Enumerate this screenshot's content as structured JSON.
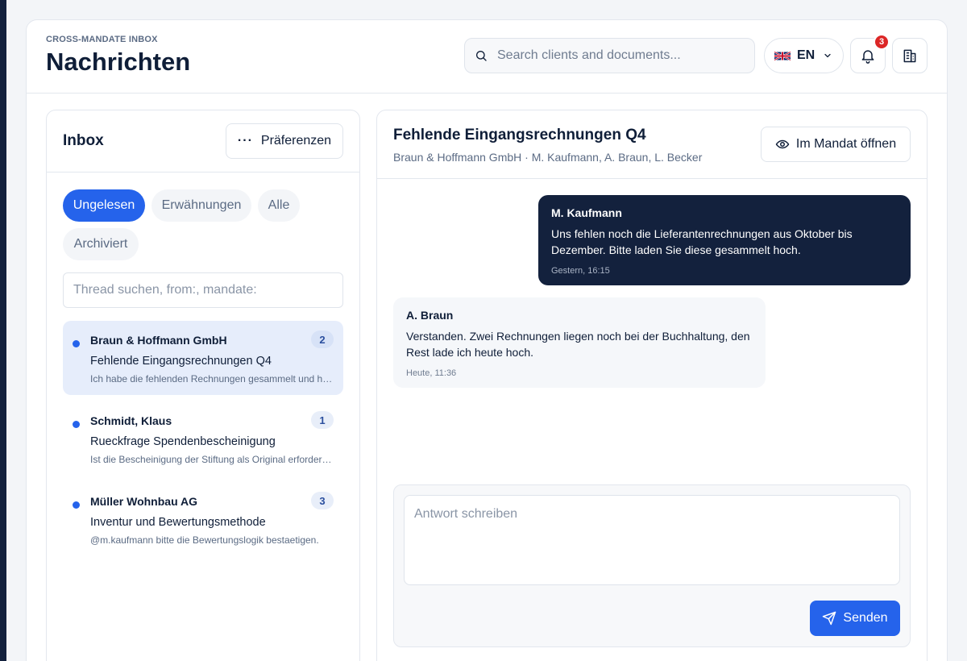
{
  "header": {
    "eyebrow": "CROSS-MANDATE INBOX",
    "title": "Nachrichten",
    "search_placeholder": "Search clients and documents...",
    "language": "EN",
    "notification_count": "3"
  },
  "inbox": {
    "title": "Inbox",
    "preferences_label": "Präferenzen",
    "tabs": [
      {
        "label": "Ungelesen",
        "active": true
      },
      {
        "label": "Erwähnungen",
        "active": false
      },
      {
        "label": "Alle",
        "active": false
      },
      {
        "label": "Archiviert",
        "active": false
      }
    ],
    "filter_placeholder": "Thread suchen, from:, mandate:",
    "threads": [
      {
        "client": "Braun & Hoffmann GmbH",
        "count": "2",
        "subject": "Fehlende Eingangsrechnungen Q4",
        "preview": "Ich habe die fehlenden Rechnungen gesammelt und hochgeladen.",
        "selected": true
      },
      {
        "client": "Schmidt, Klaus",
        "count": "1",
        "subject": "Rueckfrage Spendenbescheinigung",
        "preview": "Ist die Bescheinigung der Stiftung als Original erforderlich?",
        "selected": false
      },
      {
        "client": "Müller Wohnbau AG",
        "count": "3",
        "subject": "Inventur und Bewertungsmethode",
        "preview": "@m.kaufmann bitte die Bewertungslogik bestaetigen.",
        "selected": false
      }
    ]
  },
  "conversation": {
    "title": "Fehlende Eingangsrechnungen Q4",
    "meta": "Braun & Hoffmann GmbH · M. Kaufmann, A. Braun, L. Becker",
    "open_label": "Im Mandat öffnen",
    "messages": [
      {
        "author": "M. Kaufmann",
        "body": "Uns fehlen noch die Lieferantenrechnungen aus Oktober bis Dezember. Bitte laden Sie diese gesammelt hoch.",
        "time": "Gestern, 16:15",
        "direction": "outgoing"
      },
      {
        "author": "A. Braun",
        "body": "Verstanden. Zwei Rechnungen liegen noch bei der Buchhaltung, den Rest lade ich heute hoch.",
        "time": "Heute, 11:36",
        "direction": "incoming"
      }
    ],
    "reply_placeholder": "Antwort schreiben",
    "send_label": "Senden"
  },
  "colors": {
    "accent": "#2563eb",
    "navy": "#13213d",
    "badge_red": "#dc2626"
  },
  "icons": {
    "search": "search-icon",
    "language_flag": "uk-flag-icon",
    "language_chevron": "chevron-down-icon",
    "notifications": "bell-icon",
    "mandates": "building-icon",
    "preferences": "more-dots-icon",
    "open_mandate": "eye-icon",
    "send": "send-icon"
  }
}
